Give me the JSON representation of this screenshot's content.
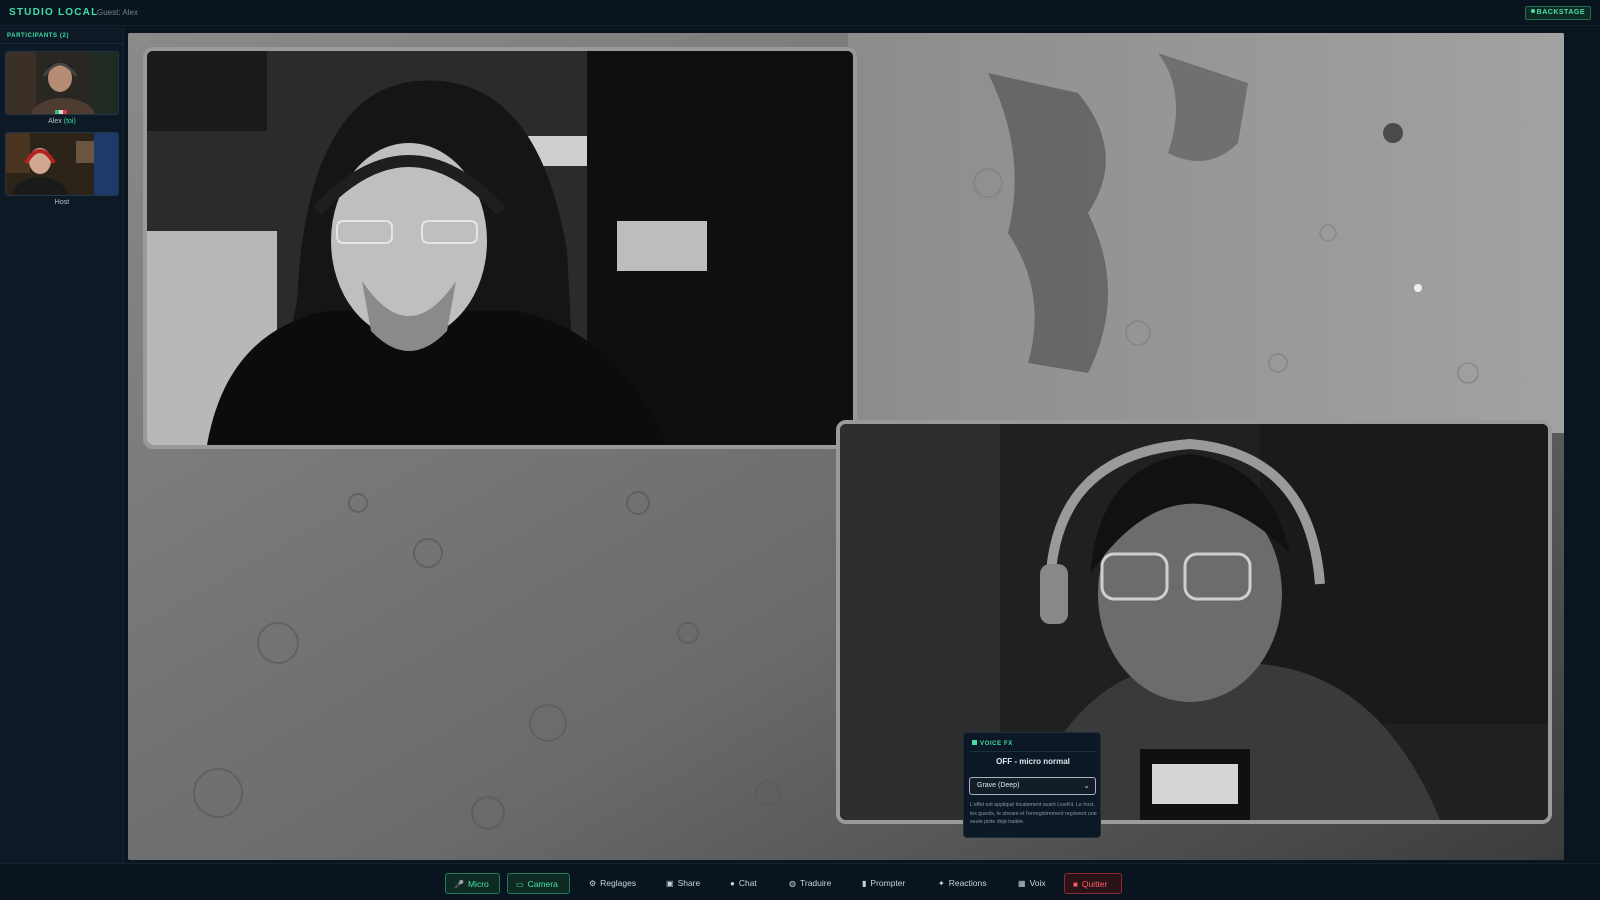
{
  "app": {
    "brand": "STUDIO LOCAL",
    "guest_label": "Guest: Alex",
    "backstage_label": "BACKSTAGE"
  },
  "sidebar": {
    "title": "PARTICIPANTS (2)",
    "participants": [
      {
        "name": "Alex",
        "tag": "(toi)"
      },
      {
        "name": "Host",
        "tag": ""
      }
    ]
  },
  "voice_fx": {
    "title": "VOICE FX",
    "status": "OFF - micro normal",
    "selected": "Grave (Deep)",
    "note": "L'effet est appliqué localement avant LiveKit. Le host, les guests, le stream et l'enregistrement reçoivent une seule piste déjà traitée."
  },
  "toolbar": {
    "buttons": [
      {
        "label": "Micro",
        "icon": "microphone-icon"
      },
      {
        "label": "Camera",
        "icon": "camera-icon"
      },
      {
        "label": "Reglages",
        "icon": "gear-icon"
      },
      {
        "label": "Share",
        "icon": "screen-share-icon"
      },
      {
        "label": "Chat",
        "icon": "chat-bubble-icon"
      },
      {
        "label": "Traduire",
        "icon": "globe-icon"
      },
      {
        "label": "Prompter",
        "icon": "prompter-icon"
      },
      {
        "label": "Reactions",
        "icon": "sparkle-icon"
      },
      {
        "label": "Voix",
        "icon": "voice-icon"
      },
      {
        "label": "Quitter",
        "icon": "exit-icon"
      }
    ]
  },
  "colors": {
    "accent": "#3fe0a8",
    "background": "#0b1520",
    "danger": "#ff5d6a"
  }
}
